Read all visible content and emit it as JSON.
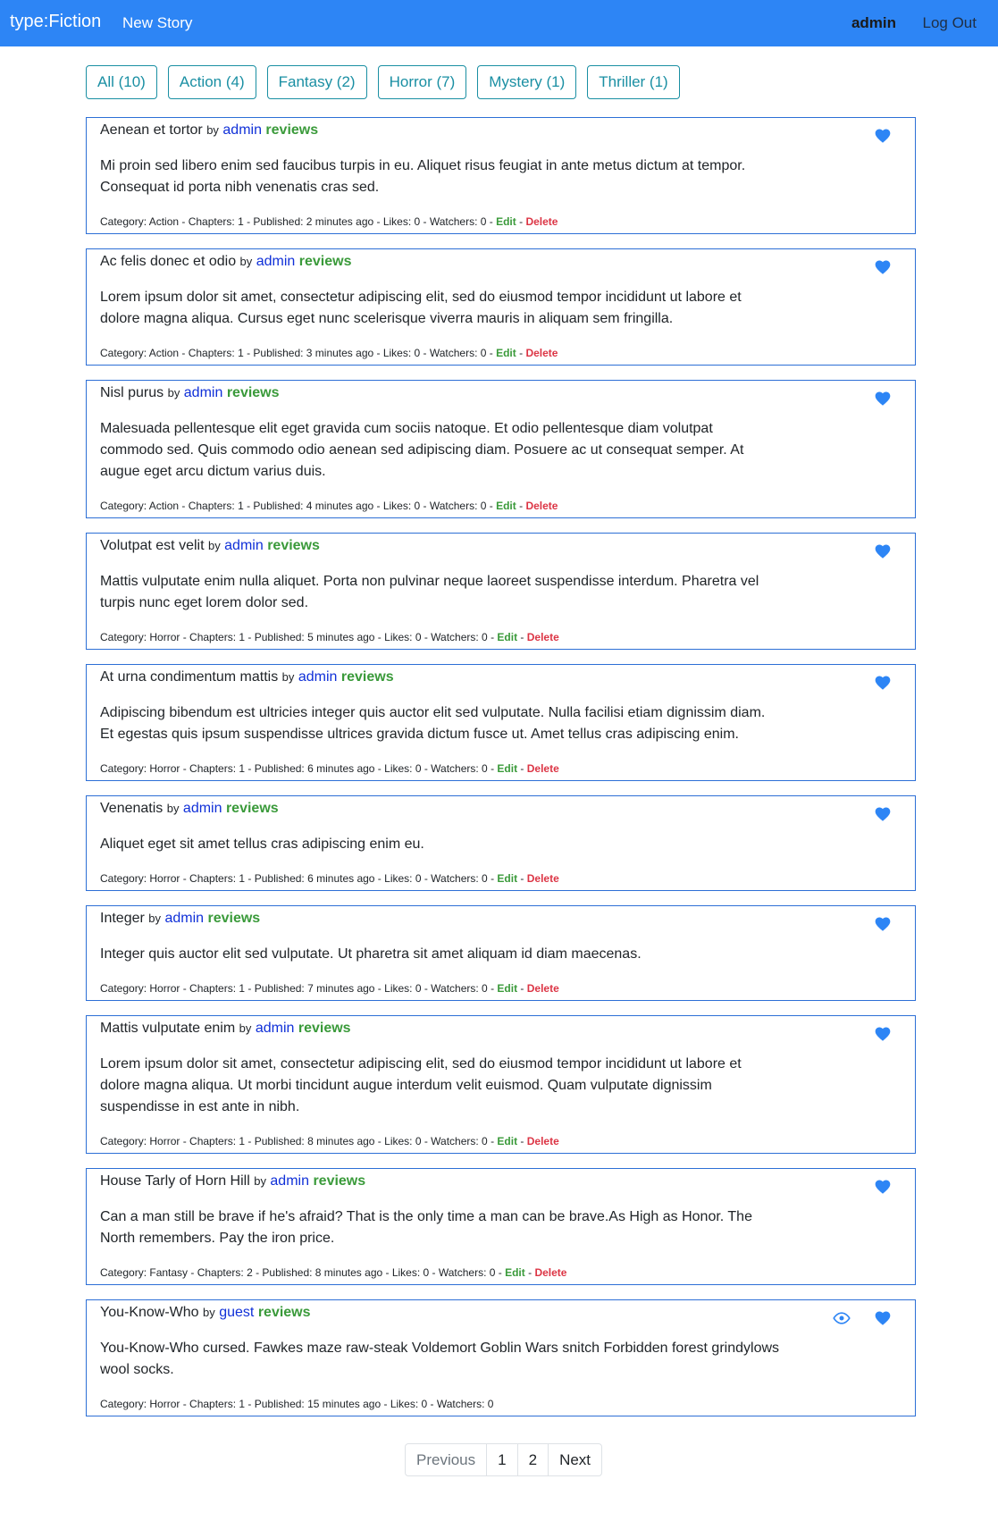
{
  "nav": {
    "brand": "type:Fiction",
    "new_story": "New Story",
    "user": "admin",
    "logout": "Log Out"
  },
  "filters": [
    "All (10)",
    "Action (4)",
    "Fantasy (2)",
    "Horror (7)",
    "Mystery (1)",
    "Thriller (1)"
  ],
  "by_label": "by",
  "reviews_label": "reviews",
  "edit_label": "Edit",
  "delete_label": "Delete",
  "stories": [
    {
      "title": "Aenean et tortor",
      "author": "admin",
      "body": "Mi proin sed libero enim sed faucibus turpis in eu. Aliquet risus feugiat in ante metus dictum at tempor. Consequat id porta nibh venenatis cras sed.",
      "meta": "Category: Action - Chapters: 1 - Published: 2 minutes ago - Likes: 0 - Watchers: 0",
      "owner": true,
      "watch": false
    },
    {
      "title": "Ac felis donec et odio",
      "author": "admin",
      "body": "Lorem ipsum dolor sit amet, consectetur adipiscing elit, sed do eiusmod tempor incididunt ut labore et dolore magna aliqua. Cursus eget nunc scelerisque viverra mauris in aliquam sem fringilla.",
      "meta": "Category: Action - Chapters: 1 - Published: 3 minutes ago - Likes: 0 - Watchers: 0",
      "owner": true,
      "watch": false
    },
    {
      "title": "Nisl purus",
      "author": "admin",
      "body": "Malesuada pellentesque elit eget gravida cum sociis natoque. Et odio pellentesque diam volutpat commodo sed. Quis commodo odio aenean sed adipiscing diam. Posuere ac ut consequat semper. At augue eget arcu dictum varius duis.",
      "meta": "Category: Action - Chapters: 1 - Published: 4 minutes ago - Likes: 0 - Watchers: 0",
      "owner": true,
      "watch": false
    },
    {
      "title": "Volutpat est velit",
      "author": "admin",
      "body": "Mattis vulputate enim nulla aliquet. Porta non pulvinar neque laoreet suspendisse interdum. Pharetra vel turpis nunc eget lorem dolor sed.",
      "meta": "Category: Horror - Chapters: 1 - Published: 5 minutes ago - Likes: 0 - Watchers: 0",
      "owner": true,
      "watch": false
    },
    {
      "title": "At urna condimentum mattis",
      "author": "admin",
      "body": "Adipiscing bibendum est ultricies integer quis auctor elit sed vulputate. Nulla facilisi etiam dignissim diam. Et egestas quis ipsum suspendisse ultrices gravida dictum fusce ut. Amet tellus cras adipiscing enim.",
      "meta": "Category: Horror - Chapters: 1 - Published: 6 minutes ago - Likes: 0 - Watchers: 0",
      "owner": true,
      "watch": false
    },
    {
      "title": "Venenatis",
      "author": "admin",
      "body": "Aliquet eget sit amet tellus cras adipiscing enim eu.",
      "meta": "Category: Horror - Chapters: 1 - Published: 6 minutes ago - Likes: 0 - Watchers: 0",
      "owner": true,
      "watch": false
    },
    {
      "title": "Integer",
      "author": "admin",
      "body": "Integer quis auctor elit sed vulputate. Ut pharetra sit amet aliquam id diam maecenas.",
      "meta": "Category: Horror - Chapters: 1 - Published: 7 minutes ago - Likes: 0 - Watchers: 0",
      "owner": true,
      "watch": false
    },
    {
      "title": "Mattis vulputate enim",
      "author": "admin",
      "body": "Lorem ipsum dolor sit amet, consectetur adipiscing elit, sed do eiusmod tempor incididunt ut labore et dolore magna aliqua. Ut morbi tincidunt augue interdum velit euismod. Quam vulputate dignissim suspendisse in est ante in nibh.",
      "meta": "Category: Horror - Chapters: 1 - Published: 8 minutes ago - Likes: 0 - Watchers: 0",
      "owner": true,
      "watch": false
    },
    {
      "title": "House Tarly of Horn Hill",
      "author": "admin",
      "body": "Can a man still be brave if he's afraid? That is the only time a man can be brave.As High as Honor. The North remembers. Pay the iron price.",
      "meta": "Category: Fantasy - Chapters: 2 - Published: 8 minutes ago - Likes: 0 - Watchers: 0",
      "owner": true,
      "watch": false
    },
    {
      "title": "You-Know-Who",
      "author": "guest",
      "body": "You-Know-Who cursed. Fawkes maze raw-steak Voldemort Goblin Wars snitch Forbidden forest grindylows wool socks.",
      "meta": "Category: Horror - Chapters: 1 - Published: 15 minutes ago - Likes: 0 - Watchers: 0",
      "owner": false,
      "watch": true
    }
  ],
  "pagination": {
    "previous": "Previous",
    "pages": [
      "1",
      "2"
    ],
    "next": "Next"
  },
  "icons": {
    "like": "heart-icon",
    "watch": "eye-icon"
  },
  "colors": {
    "navbar": "#2d85f5",
    "accent_green": "#3a9a3a",
    "danger": "#dc3545",
    "link_blue": "#1030d8",
    "filter_teal": "#1a8fa3"
  }
}
